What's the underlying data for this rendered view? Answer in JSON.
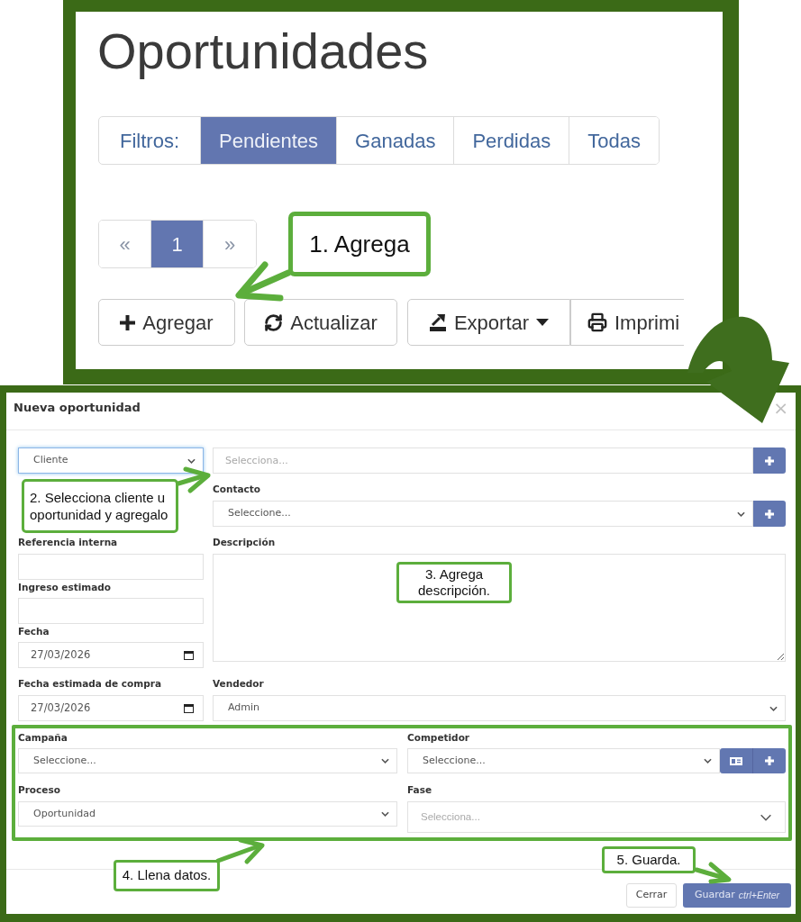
{
  "list_page": {
    "title": "Oportunidades",
    "filters": {
      "label": "Filtros:",
      "options": [
        {
          "label": "Pendientes",
          "selected": true
        },
        {
          "label": "Ganadas",
          "selected": false
        },
        {
          "label": "Perdidas",
          "selected": false
        },
        {
          "label": "Todas",
          "selected": false
        }
      ]
    },
    "pagination": [
      {
        "label": "«",
        "selected": false
      },
      {
        "label": "1",
        "selected": true
      },
      {
        "label": "»",
        "selected": false
      }
    ],
    "toolbar": [
      {
        "label": "Agregar",
        "kind": "button"
      },
      {
        "label": "Actualizar",
        "kind": "button"
      },
      {
        "label": "Exportar",
        "kind": "dropdown"
      },
      {
        "label": "Imprimi",
        "kind": "button"
      }
    ]
  },
  "modal": {
    "title": "Nueva oportunidad",
    "close": "×",
    "source_type": {
      "value": "Cliente",
      "focused": true
    },
    "source": {
      "placeholder": "Selecciona..."
    },
    "contact": {
      "label": "Contacto",
      "value": "Seleccione..."
    },
    "internal_reference": {
      "label": "Referencia interna"
    },
    "estimated_income": {
      "label": "Ingreso estimado"
    },
    "date": {
      "label": "Fecha",
      "value": "27/03/2026"
    },
    "estimated_purchase_date": {
      "label": "Fecha estimada de compra",
      "value": "27/03/2026"
    },
    "description": {
      "label": "Descripción"
    },
    "seller": {
      "label": "Vendedor",
      "value": "Admin"
    },
    "campaign": {
      "label": "Campaña",
      "value": "Seleccione..."
    },
    "competitor": {
      "label": "Competidor",
      "value": "Seleccione..."
    },
    "process": {
      "label": "Proceso",
      "value": "Oportunidad"
    },
    "phase": {
      "label": "Fase",
      "placeholder": "Selecciona..."
    },
    "buttons": [
      {
        "label": "Cerrar",
        "kind": "secondary"
      },
      {
        "label": "Guardar",
        "shortcut": "ctrl+Enter",
        "kind": "primary"
      }
    ]
  },
  "annotations": [
    {
      "text": "1. Agrega"
    },
    {
      "text": "2. Selecciona cliente u oportunidad y agregalo"
    },
    {
      "text": "3. Agrega descripción."
    },
    {
      "text": "4. Llena datos."
    },
    {
      "text": "5. Guarda."
    }
  ]
}
